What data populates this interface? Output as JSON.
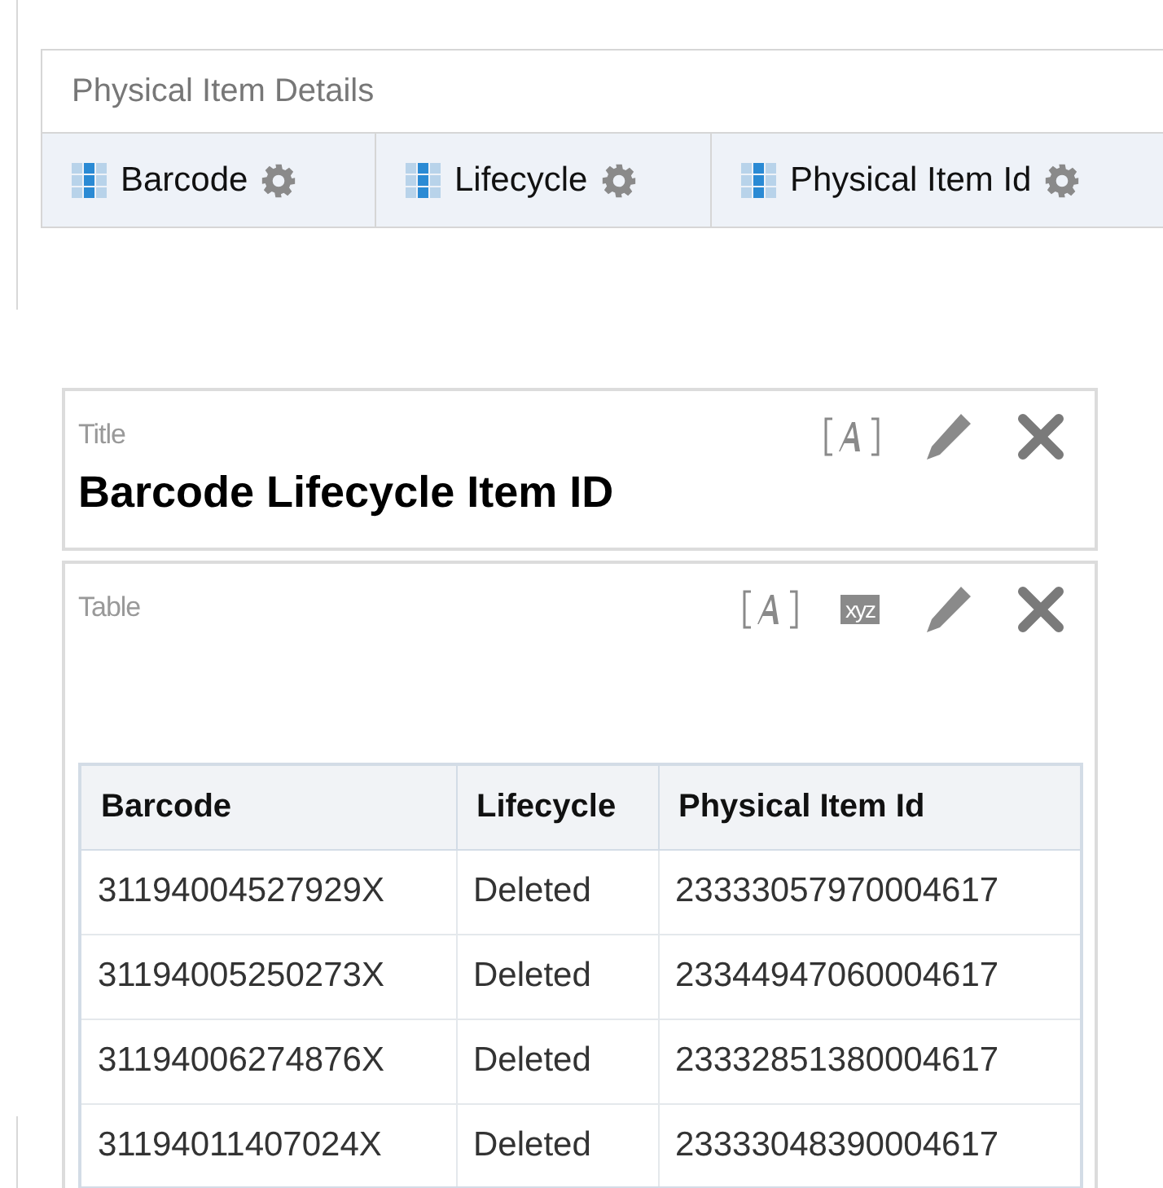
{
  "criteria_panel": {
    "title": "Physical Item Details",
    "columns": [
      {
        "label": "Barcode"
      },
      {
        "label": "Lifecycle"
      },
      {
        "label": "Physical Item Id"
      }
    ]
  },
  "title_view": {
    "label": "Title",
    "text": "Barcode Lifecycle Item ID"
  },
  "table_view": {
    "label": "Table",
    "format_badge": "xyz",
    "table": {
      "columns": [
        "Barcode",
        "Lifecycle",
        "Physical Item Id"
      ],
      "rows": [
        [
          "31194004527929X",
          "Deleted",
          "23333057970004617"
        ],
        [
          "31194005250273X",
          "Deleted",
          "23344947060004617"
        ],
        [
          "31194006274876X",
          "Deleted",
          "23332851380004617"
        ],
        [
          "31194011407024X",
          "Deleted",
          "23333048390004617"
        ]
      ]
    }
  }
}
